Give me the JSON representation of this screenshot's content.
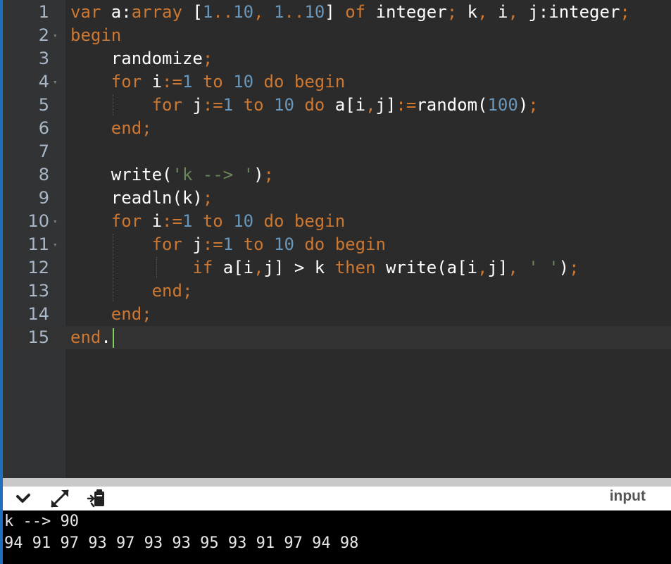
{
  "editor": {
    "lines": [
      {
        "num": "1",
        "tokens": [
          [
            "kw",
            "var "
          ],
          [
            "pl",
            "a:"
          ],
          [
            "kw",
            "array "
          ],
          [
            "pl",
            "["
          ],
          [
            "num",
            "1"
          ],
          [
            "kw",
            ".."
          ],
          [
            "num",
            "10"
          ],
          [
            "kw",
            ", "
          ],
          [
            "num",
            "1"
          ],
          [
            "kw",
            ".."
          ],
          [
            "num",
            "10"
          ],
          [
            "pl",
            "] "
          ],
          [
            "kw",
            "of "
          ],
          [
            "pl",
            "integer"
          ],
          [
            "kw",
            "; "
          ],
          [
            "pl",
            "k"
          ],
          [
            "kw",
            ", "
          ],
          [
            "pl",
            "i"
          ],
          [
            "kw",
            ", "
          ],
          [
            "pl",
            "j:integer"
          ],
          [
            "kw",
            ";"
          ]
        ]
      },
      {
        "num": "2",
        "fold": true,
        "tokens": [
          [
            "kw",
            "begin"
          ]
        ]
      },
      {
        "num": "3",
        "tokens": [
          [
            "pl",
            "    randomize"
          ],
          [
            "kw",
            ";"
          ]
        ]
      },
      {
        "num": "4",
        "fold": true,
        "tokens": [
          [
            "pl",
            "    "
          ],
          [
            "kw",
            "for "
          ],
          [
            "pl",
            "i"
          ],
          [
            "kw",
            ":="
          ],
          [
            "num",
            "1"
          ],
          [
            "kw",
            " to "
          ],
          [
            "num",
            "10"
          ],
          [
            "kw",
            " do begin"
          ]
        ]
      },
      {
        "num": "5",
        "tokens": [
          [
            "pl",
            "        "
          ],
          [
            "kw",
            "for "
          ],
          [
            "pl",
            "j"
          ],
          [
            "kw",
            ":="
          ],
          [
            "num",
            "1"
          ],
          [
            "kw",
            " to "
          ],
          [
            "num",
            "10"
          ],
          [
            "kw",
            " do "
          ],
          [
            "pl",
            "a[i"
          ],
          [
            "kw",
            ","
          ],
          [
            "pl",
            "j]"
          ],
          [
            "kw",
            ":="
          ],
          [
            "pl",
            "random("
          ],
          [
            "num",
            "100"
          ],
          [
            "pl",
            ")"
          ],
          [
            "kw",
            ";"
          ]
        ]
      },
      {
        "num": "6",
        "tokens": [
          [
            "pl",
            "    "
          ],
          [
            "kw",
            "end;"
          ]
        ]
      },
      {
        "num": "7",
        "tokens": []
      },
      {
        "num": "8",
        "tokens": [
          [
            "pl",
            "    write("
          ],
          [
            "str",
            "'k --> '"
          ],
          [
            "pl",
            ")"
          ],
          [
            "kw",
            ";"
          ]
        ]
      },
      {
        "num": "9",
        "tokens": [
          [
            "pl",
            "    readln(k)"
          ],
          [
            "kw",
            ";"
          ]
        ]
      },
      {
        "num": "10",
        "fold": true,
        "tokens": [
          [
            "pl",
            "    "
          ],
          [
            "kw",
            "for "
          ],
          [
            "pl",
            "i"
          ],
          [
            "kw",
            ":="
          ],
          [
            "num",
            "1"
          ],
          [
            "kw",
            " to "
          ],
          [
            "num",
            "10"
          ],
          [
            "kw",
            " do begin"
          ]
        ]
      },
      {
        "num": "11",
        "fold": true,
        "tokens": [
          [
            "pl",
            "        "
          ],
          [
            "kw",
            "for "
          ],
          [
            "pl",
            "j"
          ],
          [
            "kw",
            ":="
          ],
          [
            "num",
            "1"
          ],
          [
            "kw",
            " to "
          ],
          [
            "num",
            "10"
          ],
          [
            "kw",
            " do begin"
          ]
        ]
      },
      {
        "num": "12",
        "tokens": [
          [
            "pl",
            "            "
          ],
          [
            "kw",
            "if "
          ],
          [
            "pl",
            "a[i"
          ],
          [
            "kw",
            ","
          ],
          [
            "pl",
            "j] > k "
          ],
          [
            "kw",
            "then "
          ],
          [
            "pl",
            "write(a[i"
          ],
          [
            "kw",
            ","
          ],
          [
            "pl",
            "j]"
          ],
          [
            "kw",
            ", "
          ],
          [
            "str",
            "' '"
          ],
          [
            "pl",
            ")"
          ],
          [
            "kw",
            ";"
          ]
        ]
      },
      {
        "num": "13",
        "tokens": [
          [
            "pl",
            "        "
          ],
          [
            "kw",
            "end;"
          ]
        ]
      },
      {
        "num": "14",
        "tokens": [
          [
            "pl",
            "    "
          ],
          [
            "kw",
            "end;"
          ]
        ]
      },
      {
        "num": "15",
        "active": true,
        "tokens": [
          [
            "kw",
            "end"
          ],
          [
            "pl",
            "."
          ]
        ]
      }
    ]
  },
  "toolbar": {
    "collapse_icon": "chevron-down-icon",
    "expand_icon": "expand-arrows-icon",
    "run_icon": "clipboard-run-icon",
    "input_label": "input"
  },
  "console": {
    "lines": [
      "k --> 90",
      "94 91 97 93 97 93 93 95 93 91 97 94 98"
    ]
  },
  "colors": {
    "keyword": "#cc7832",
    "number": "#6897bb",
    "string": "#6a8759",
    "plain": "#ffffff",
    "background": "#2b2b2b",
    "accent": "#1f6fbf"
  }
}
